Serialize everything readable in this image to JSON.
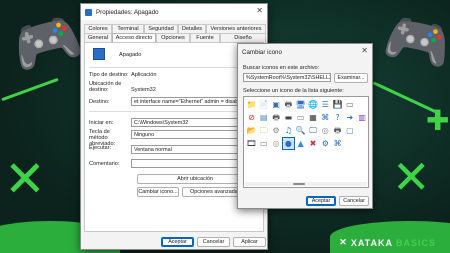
{
  "main_dialog": {
    "title": "Propiedades: Apagado",
    "close_glyph": "✕",
    "tabs_row1": [
      "Colores",
      "Terminal",
      "Seguridad",
      "Detalles",
      "Versiones anteriores"
    ],
    "tabs_row2": [
      "General",
      "Acceso directo",
      "Opciones",
      "Fuente",
      "Diseño"
    ],
    "active_tab": "Acceso directo",
    "shortcut_name": "Apagado",
    "target_type_label": "Tipo de destino:",
    "target_type_value": "Aplicación",
    "target_location_label": "Ubicación de destino:",
    "target_location_value": "System32",
    "target_label": "Destino:",
    "target_value": "et interface name=\"Ethernet\" admin = disabled",
    "start_in_label": "Iniciar en:",
    "start_in_value": "C:\\Windows\\System32",
    "hotkey_label": "Tecla de método abreviado:",
    "hotkey_value": "Ninguno",
    "run_label": "Ejecutar:",
    "run_value": "Ventana normal",
    "comment_label": "Comentario:",
    "comment_value": "",
    "open_location_button": "Abrir ubicación",
    "change_icon_button": "Cambiar icono...",
    "advanced_button": "Opciones avanzadas...",
    "ok_button": "Aceptar",
    "cancel_button": "Cancelar",
    "apply_button": "Aplicar"
  },
  "icon_dialog": {
    "title": "Cambiar icono",
    "close_glyph": "✕",
    "search_label": "Buscar iconos en este archivo:",
    "file_path": "%SystemRoot%\\System32\\SHELL32.dll",
    "browse_button": "Examinar...",
    "list_label": "Seleccione un icono de la lista siguiente:",
    "ok_button": "Aceptar",
    "cancel_button": "Cancelar",
    "icons": [
      {
        "name": "folder-icon",
        "glyph": "📁",
        "color": "#e8b830"
      },
      {
        "name": "document-icon",
        "glyph": "📄",
        "color": "#4a7fc1"
      },
      {
        "name": "app-icon",
        "glyph": "▣",
        "color": "#3a6fb0"
      },
      {
        "name": "printer-icon",
        "glyph": "🖶",
        "color": "#555555"
      },
      {
        "name": "monitor-icon",
        "glyph": "🖥",
        "color": "#2b6cc4"
      },
      {
        "name": "globe-icon",
        "glyph": "🌐",
        "color": "#2f8fd8"
      },
      {
        "name": "document-lines-icon",
        "glyph": "☰",
        "color": "#3a6fb0"
      },
      {
        "name": "floppy-icon",
        "glyph": "💾",
        "color": "#2b4f8f"
      },
      {
        "name": "drive-icon",
        "glyph": "▭",
        "color": "#666666"
      },
      {
        "name": "blank-icon",
        "glyph": "",
        "color": "#cccccc"
      },
      {
        "name": "blocked-icon",
        "glyph": "⊘",
        "color": "#cc2a2a"
      },
      {
        "name": "window-icon",
        "glyph": "▤",
        "color": "#4a7fc1"
      },
      {
        "name": "printer-icon",
        "glyph": "🖶",
        "color": "#555555"
      },
      {
        "name": "network-drive-icon",
        "glyph": "▬",
        "color": "#444444"
      },
      {
        "name": "disc-drive-icon",
        "glyph": "▭",
        "color": "#777777"
      },
      {
        "name": "calendar-icon",
        "glyph": "▦",
        "color": "#333333"
      },
      {
        "name": "network-icon",
        "glyph": "⌘",
        "color": "#2b6cc4"
      },
      {
        "name": "help-icon",
        "glyph": "?",
        "color": "#2f6fd0"
      },
      {
        "name": "arrow-icon",
        "glyph": "➜",
        "color": "#3a6fb0"
      },
      {
        "name": "chart-icon",
        "glyph": "▥",
        "color": "#7a3fb0"
      },
      {
        "name": "folder-open-icon",
        "glyph": "📂",
        "color": "#e8b830"
      },
      {
        "name": "network-folder-icon",
        "glyph": "🗀",
        "color": "#e0a020"
      },
      {
        "name": "gear-doc-icon",
        "glyph": "⚙",
        "color": "#888888"
      },
      {
        "name": "music-icon",
        "glyph": "♫",
        "color": "#2b6cc4"
      },
      {
        "name": "search-icon",
        "glyph": "🔍",
        "color": "#2b6cc4"
      },
      {
        "name": "monitor-icon",
        "glyph": "🖵",
        "color": "#2b6cc4"
      },
      {
        "name": "cd-icon",
        "glyph": "◎",
        "color": "#888888"
      },
      {
        "name": "printer-icon",
        "glyph": "🖶",
        "color": "#555555"
      },
      {
        "name": "window-icon",
        "glyph": "▢",
        "color": "#4a7fc1"
      },
      {
        "name": "blank-icon",
        "glyph": "",
        "color": "#cccccc"
      },
      {
        "name": "film-icon",
        "glyph": "🎞",
        "color": "#333333"
      },
      {
        "name": "drives-icon",
        "glyph": "▭",
        "color": "#777777"
      },
      {
        "name": "cd-icon",
        "glyph": "◎",
        "color": "#999999"
      },
      {
        "name": "disc-icon",
        "glyph": "●",
        "color": "#2b6cc4"
      },
      {
        "name": "picture-icon",
        "glyph": "▲",
        "color": "#2b8fd8"
      },
      {
        "name": "delete-icon",
        "glyph": "✖",
        "color": "#cc3333"
      },
      {
        "name": "settings-icon",
        "glyph": "⚙",
        "color": "#2b6cc4"
      },
      {
        "name": "network-icon",
        "glyph": "⌘",
        "color": "#2b6cc4"
      },
      {
        "name": "blank-icon",
        "glyph": "",
        "color": "#cccccc"
      },
      {
        "name": "blank-icon",
        "glyph": "",
        "color": "#cccccc"
      }
    ]
  },
  "watermark": {
    "brand": "XATAKA",
    "suffix": "BASICS",
    "glyph": "✕"
  }
}
